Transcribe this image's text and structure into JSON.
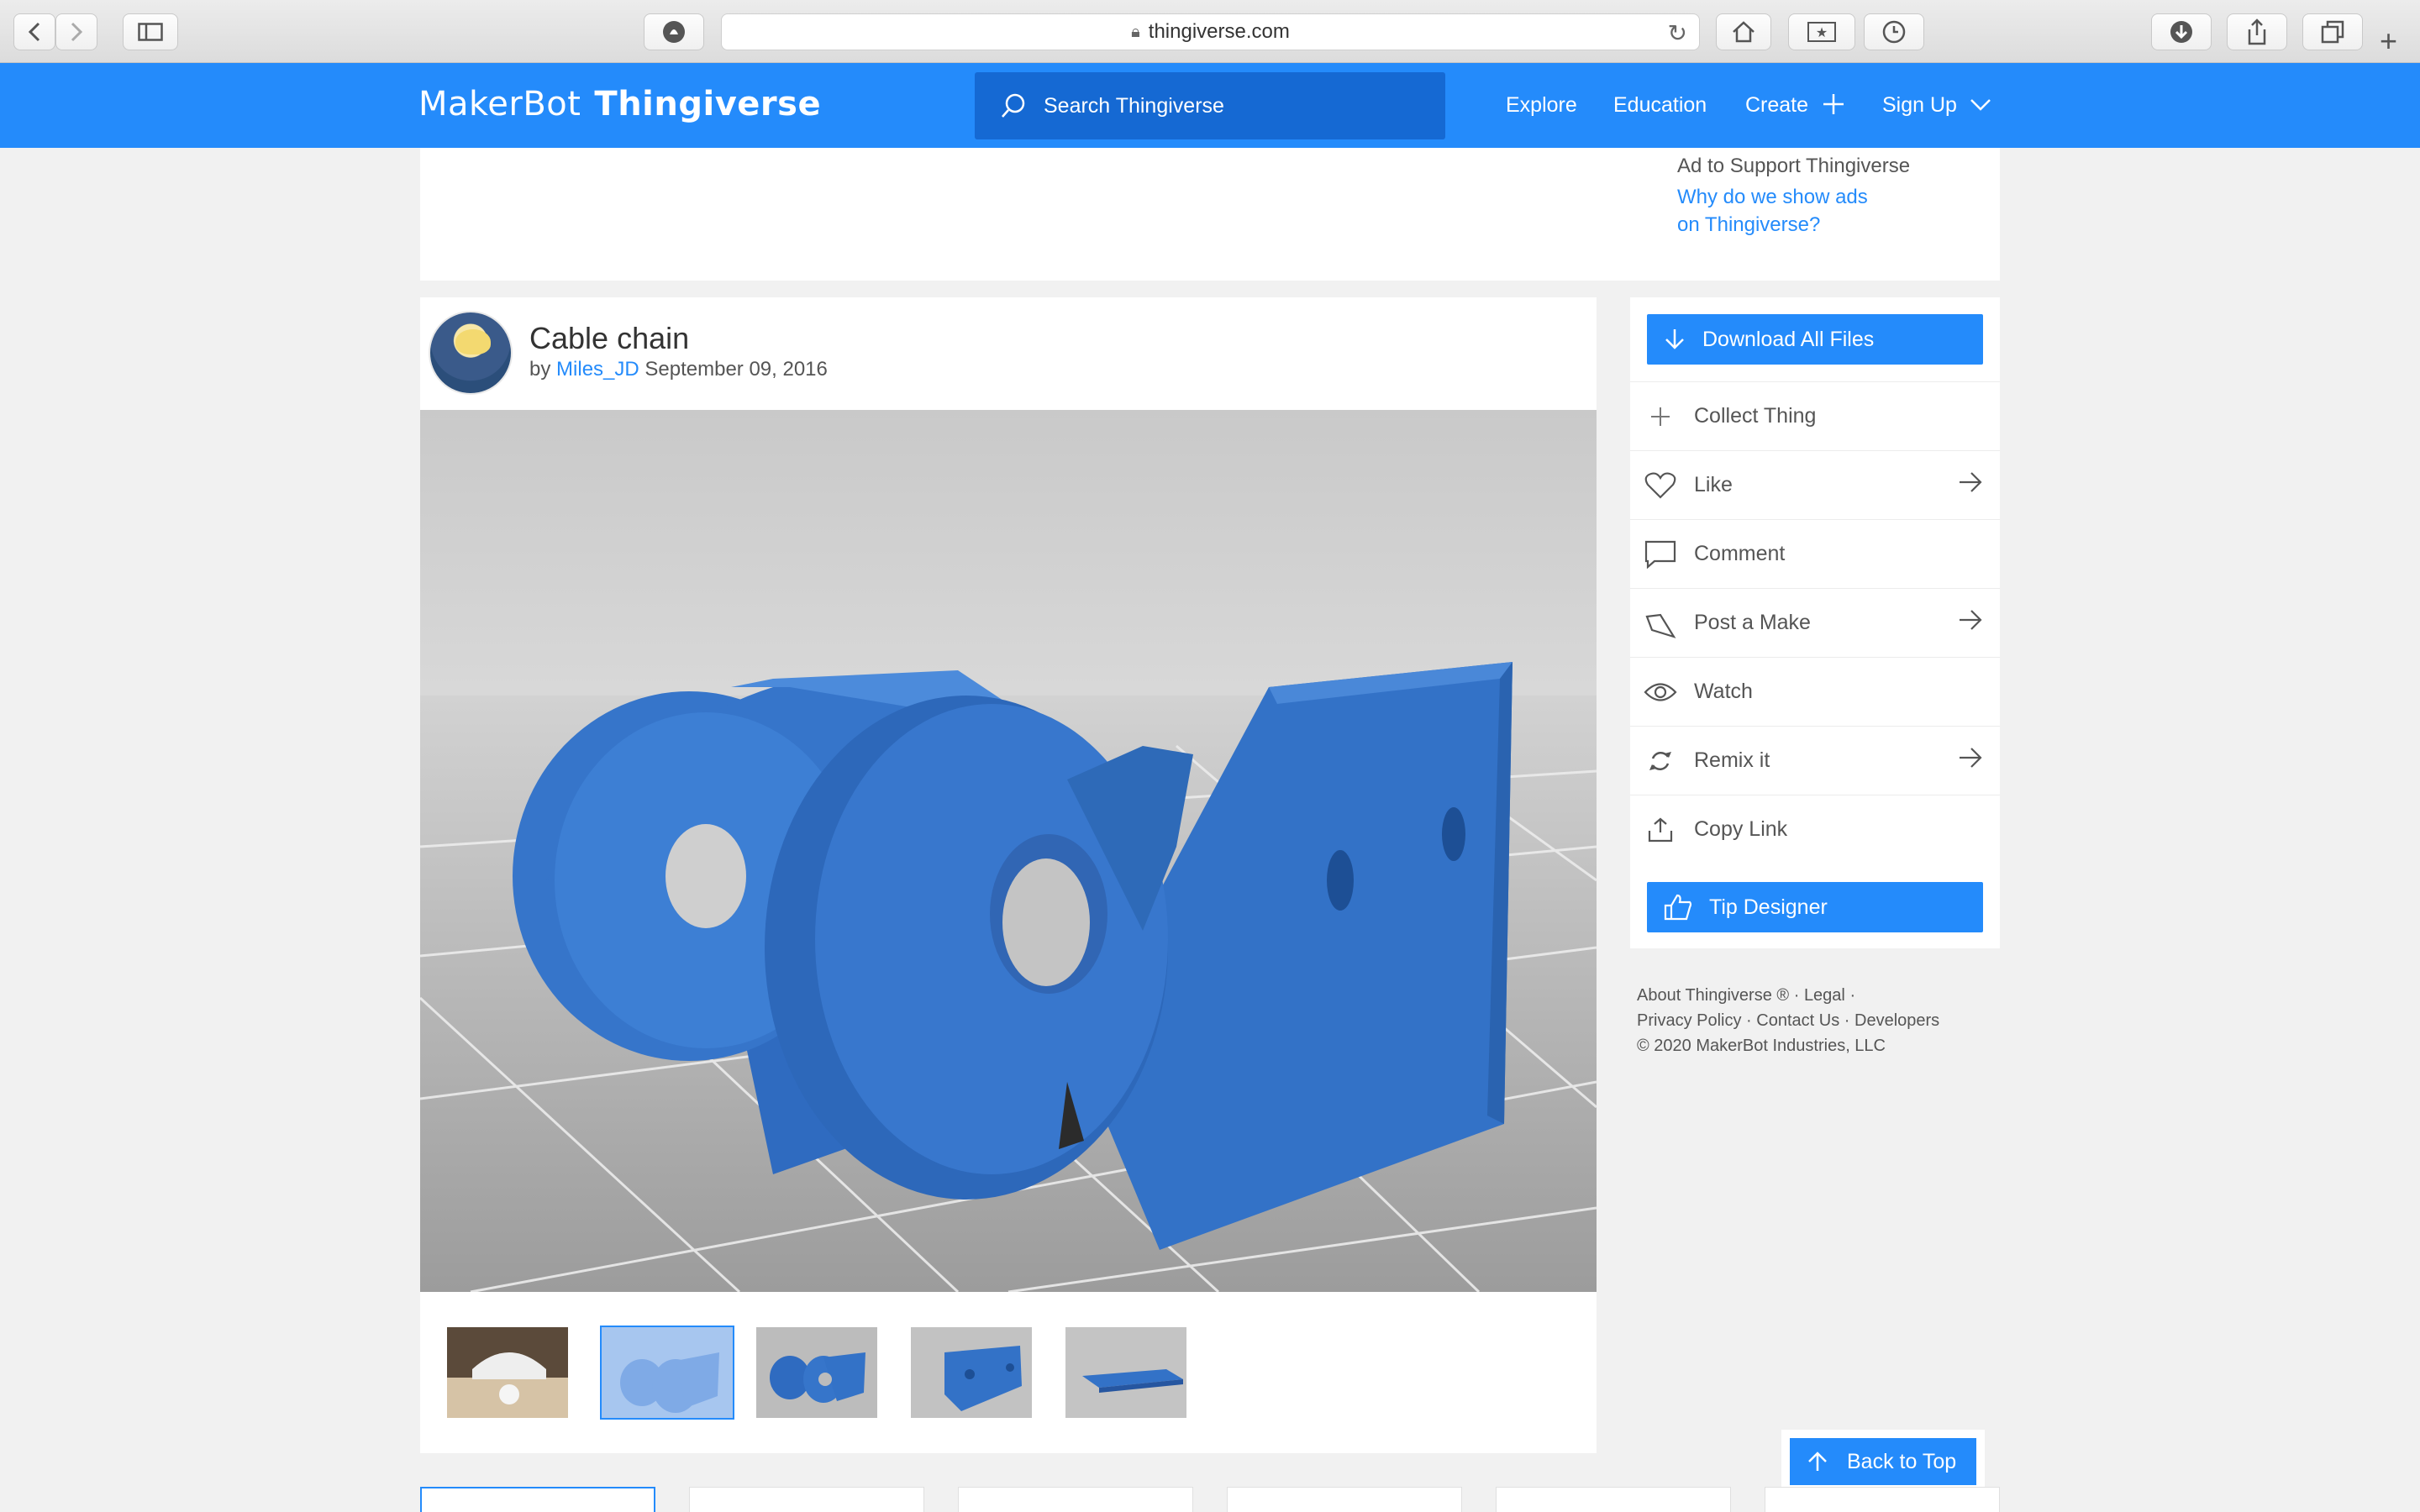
{
  "browser": {
    "url": "thingiverse.com",
    "icons": [
      "back-icon",
      "forward-icon",
      "sidebar-icon",
      "privacy-icon",
      "lock-icon",
      "reload-icon",
      "home-icon",
      "bookmark-icon",
      "history-icon",
      "download-icon",
      "share-icon",
      "tabs-icon",
      "new-tab-icon"
    ]
  },
  "header": {
    "logo_makerbot": "MakerBot",
    "logo_thingiverse": "Thingiverse",
    "search_placeholder": "Search Thingiverse",
    "nav": {
      "explore": "Explore",
      "education": "Education",
      "create": "Create",
      "signup": "Sign Up"
    }
  },
  "ad": {
    "title": "Ad to Support Thingiverse",
    "link_line1": "Why do we show ads",
    "link_line2": "on Thingiverse?"
  },
  "thing": {
    "title": "Cable chain",
    "by": "by",
    "author": "Miles_JD",
    "date": "September 09, 2016",
    "thumbnail_count": 5,
    "active_thumbnail": 2
  },
  "sidebar": {
    "download": "Download All Files",
    "collect": "Collect Thing",
    "like": "Like",
    "comment": "Comment",
    "post_make": "Post a Make",
    "watch": "Watch",
    "remix": "Remix it",
    "copy_link": "Copy Link",
    "tip": "Tip Designer"
  },
  "footer": {
    "about": "About Thingiverse ®",
    "legal": "Legal",
    "privacy": "Privacy Policy",
    "contact": "Contact Us",
    "developers": "Developers",
    "copyright": "©  2020 MakerBot Industries, LLC",
    "sep": "·"
  },
  "back_to_top": "Back to Top",
  "colors": {
    "brand_blue": "#248bfb",
    "search_blue": "#1569d3",
    "model_blue": "#2f6fc4"
  }
}
